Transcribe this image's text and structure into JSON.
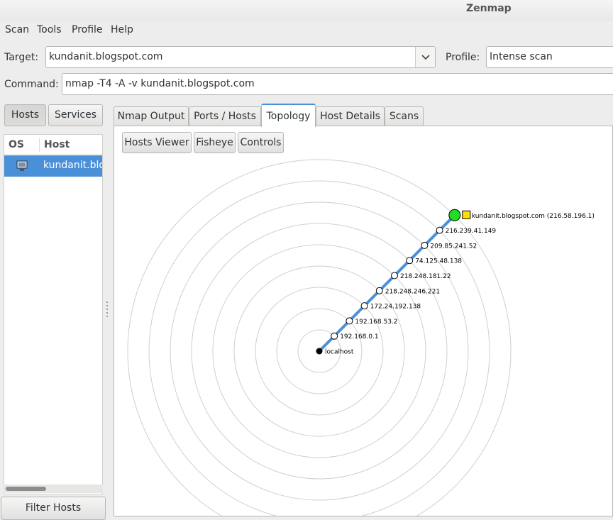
{
  "window": {
    "title": "Zenmap"
  },
  "menu": {
    "scan": "Scan",
    "tools": "Tools",
    "profile": "Profile",
    "help": "Help"
  },
  "target": {
    "label": "Target:",
    "value": "kundanit.blogspot.com"
  },
  "profile": {
    "label": "Profile:",
    "value": "Intense scan"
  },
  "command": {
    "label": "Command:",
    "value": "nmap -T4 -A -v kundanit.blogspot.com"
  },
  "left": {
    "hosts_button": "Hosts",
    "services_button": "Services",
    "col_os": "OS",
    "col_host": "Host",
    "host_name": "kundanit.blog",
    "filter_button": "Filter Hosts"
  },
  "tabs": [
    "Nmap Output",
    "Ports / Hosts",
    "Topology",
    "Host Details",
    "Scans"
  ],
  "topology": {
    "toolbar": {
      "hosts_viewer": "Hosts Viewer",
      "fisheye": "Fisheye",
      "controls": "Controls"
    },
    "nodes": [
      "localhost",
      "192.168.0.1",
      "192.168.53.2",
      "172.24.192.138",
      "218.248.246.221",
      "218.248.181.22",
      "74.125.48.138",
      "209.85.241.52",
      "216.239.41.149",
      "kundanit.blogspot.com (216.58.196.1)"
    ]
  },
  "colors": {
    "accent": "#4a90d9",
    "target_node": "#22dd22",
    "edge": "#4a90d9"
  },
  "icons": {
    "os_icon": "monitor-icon",
    "dropdown": "chevron-down-icon",
    "target_marker": "shield-icon"
  }
}
